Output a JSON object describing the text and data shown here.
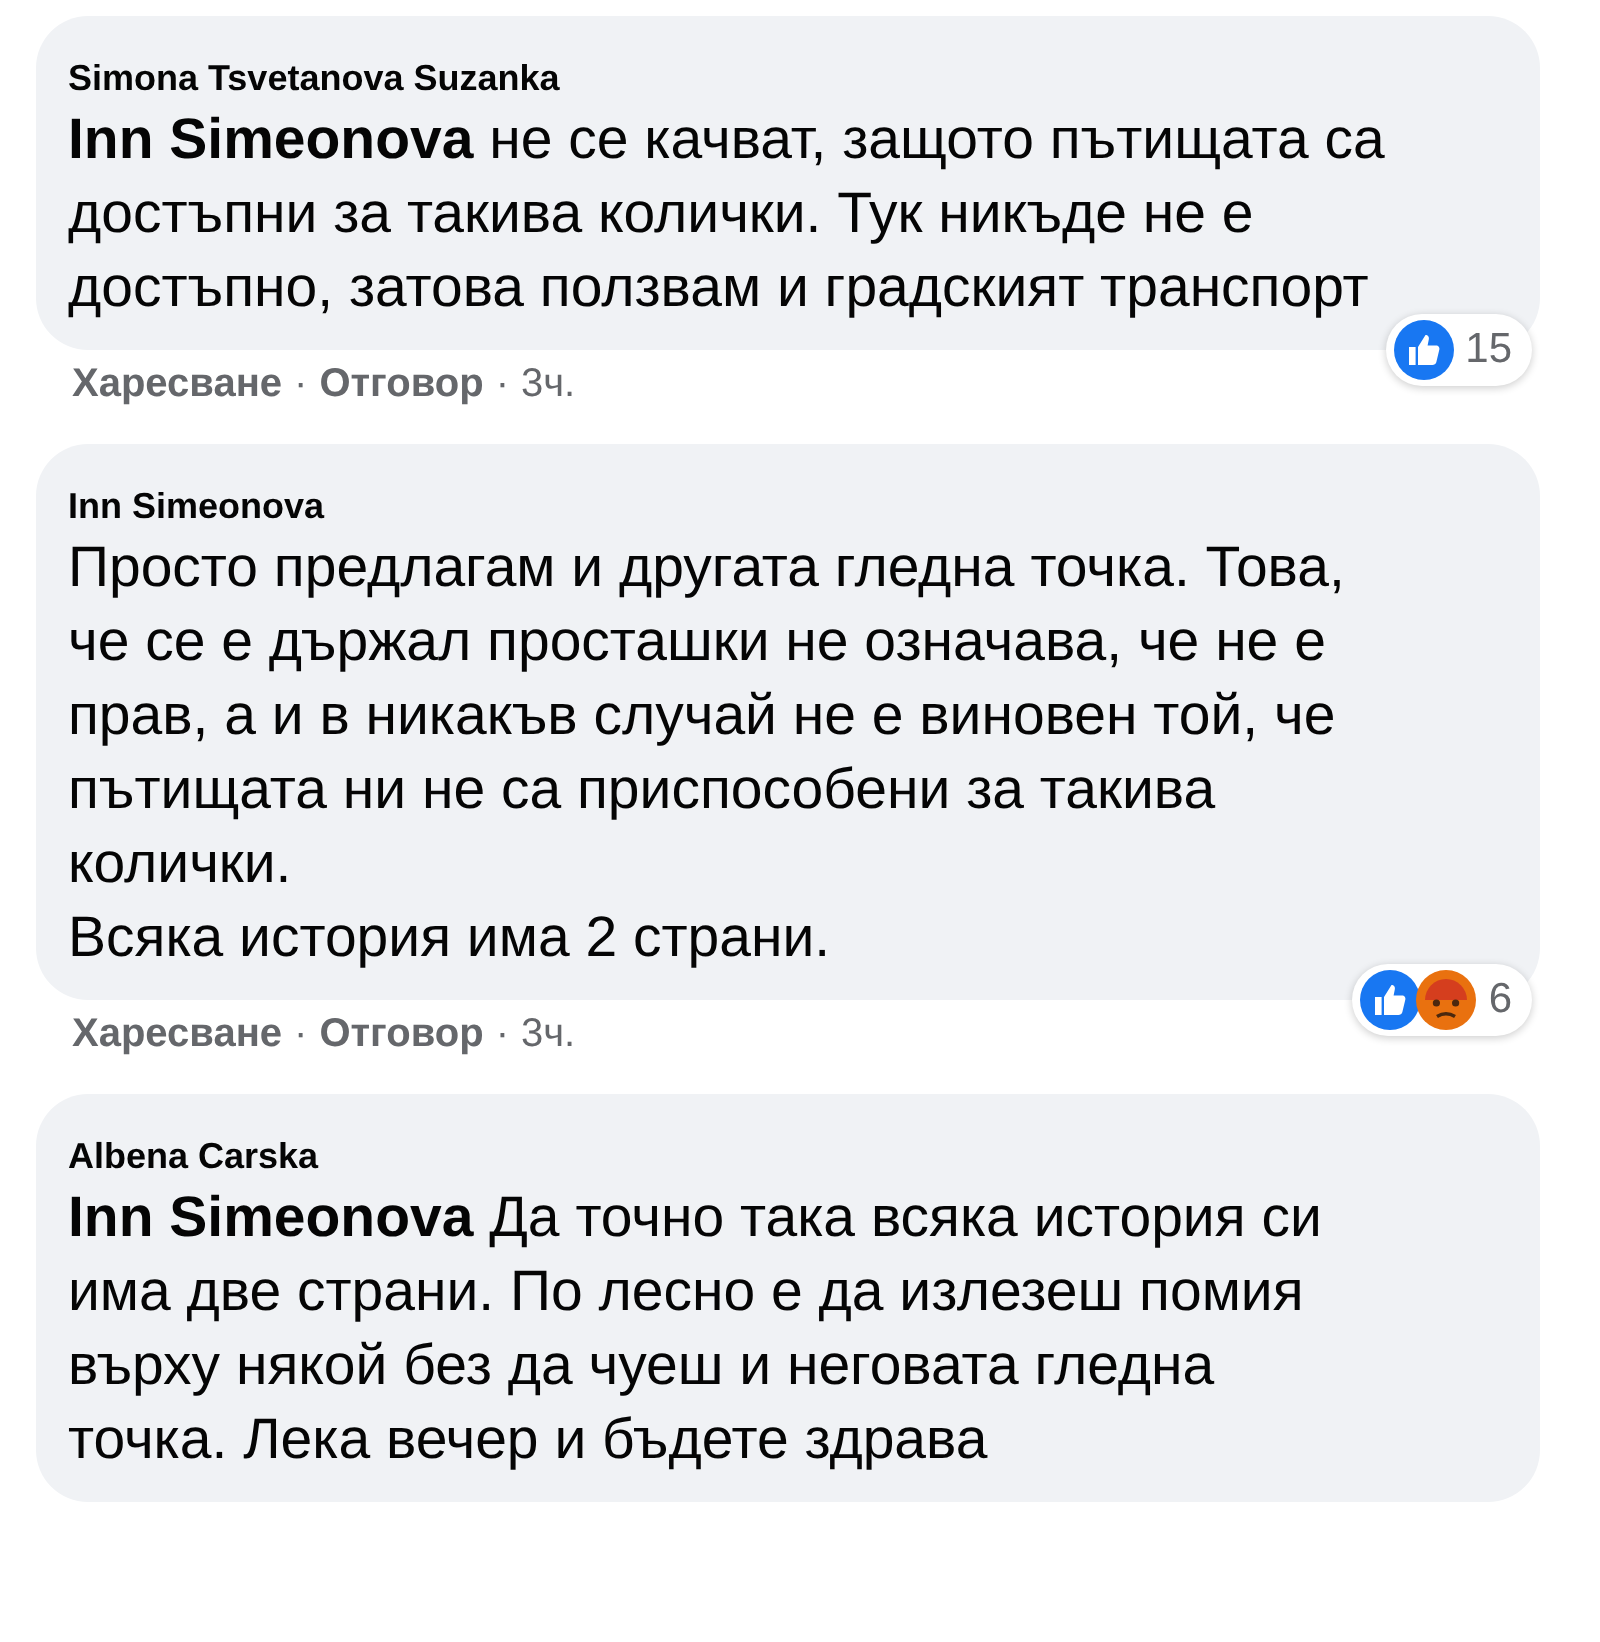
{
  "comments": [
    {
      "author": "Simona Tsvetanova Suzanka",
      "text": "**Inn Simeonova** не се качват, защото пътищата са\nдостъпни за такива колички. Тук никъде не е\nдостъпно, затова ползвам и градският транспорт",
      "reactions": {
        "icons": [
          {
            "kind": "like"
          }
        ],
        "count": "15"
      },
      "actions": {
        "like": "Харесване",
        "separator_1": "·",
        "reply": "Отговор",
        "separator_2": "·",
        "time": "3ч."
      }
    },
    {
      "author": "Inn Simeonova",
      "text": "Просто предлагам и другата гледна точка. Това,\nче се е държал просташки не означава, че не е\nправ, а и в никакъв случай не е виновен той, че\nпътищата ни не са приспособени за такива\nколички.\nВсяка история има 2 страни.",
      "reactions": {
        "icons": [
          {
            "kind": "like"
          },
          {
            "kind": "angry"
          }
        ],
        "count": "6"
      },
      "actions": {
        "like": "Харесване",
        "separator_1": "·",
        "reply": "Отговор",
        "separator_2": "·",
        "time": "3ч."
      }
    },
    {
      "author": "Albena Carska",
      "text": "**Inn Simeonova** Да точно така всяка история си\nима две страни. По лесно е да излезеш помия\nвърху някой без да чуеш и неговата гледна\nточка. Лека вечер и бъдете здрава"
    }
  ]
}
